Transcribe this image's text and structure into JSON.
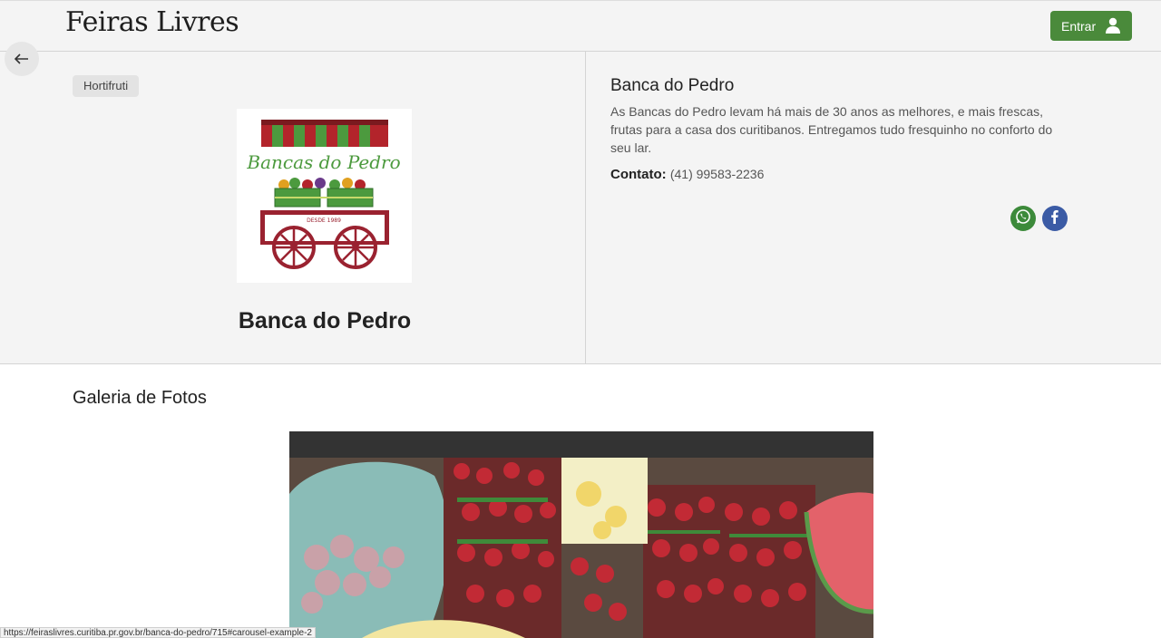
{
  "header": {
    "brand": "Feiras Livres",
    "login_label": "Entrar"
  },
  "category_tag": "Hortifruti",
  "logo": {
    "text": "Bancas do Pedro",
    "since": "DESDE 1989"
  },
  "stand": {
    "title": "Banca do Pedro",
    "description": "As Bancas do Pedro levam há mais de 30 anos as melhores, e mais frescas, frutas para a casa dos curitibanos. Entregamos tudo fresquinho no conforto do seu lar.",
    "contact_label": "Contato:",
    "contact_value": "(41) 99583-2236"
  },
  "gallery": {
    "title": "Galeria de Fotos"
  },
  "status_bar": {
    "url": "https://feiraslivres.curitiba.pr.gov.br/banca-do-pedro/715#carousel-example-2"
  },
  "colors": {
    "login_button": "#4a8a3b",
    "whatsapp": "#3c8a3a",
    "facebook": "#3b5ba5"
  },
  "icons": [
    "back-arrow-icon",
    "user-icon",
    "whatsapp-icon",
    "facebook-icon"
  ]
}
